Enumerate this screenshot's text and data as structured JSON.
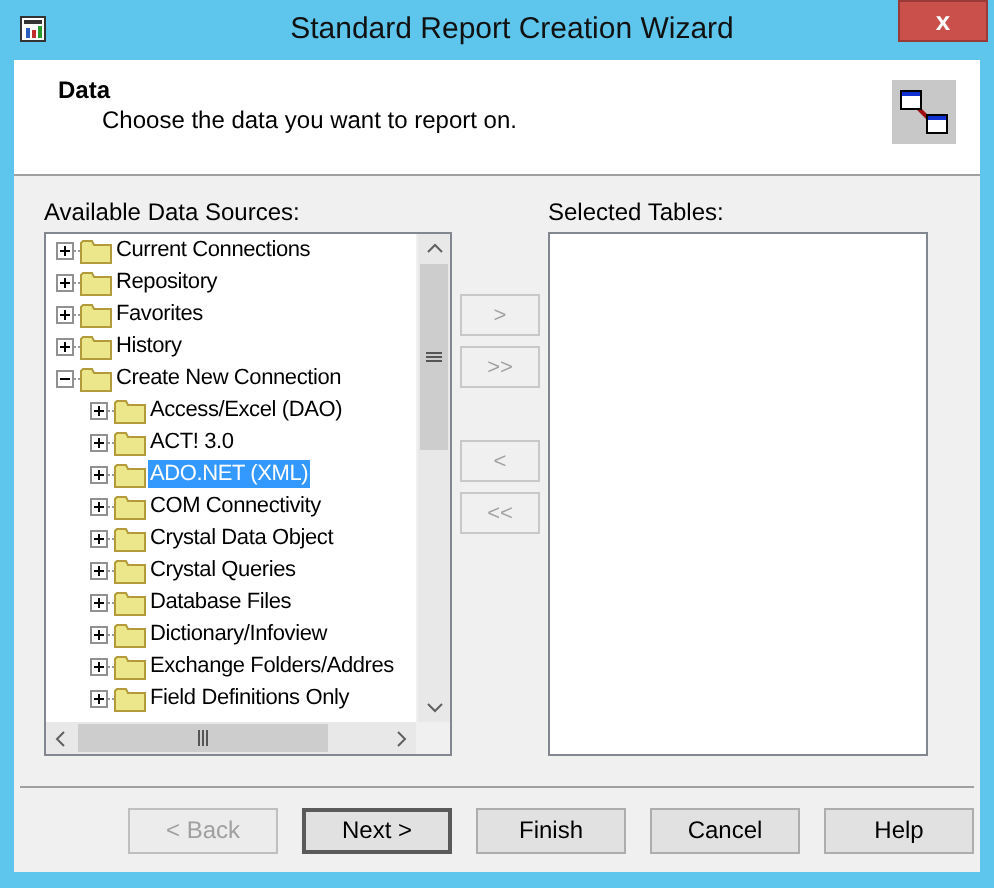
{
  "window": {
    "title": "Standard Report Creation Wizard",
    "close": "x"
  },
  "header": {
    "title": "Data",
    "subtitle": "Choose the data you want to report on."
  },
  "available": {
    "label": "Available Data Sources:",
    "items": [
      {
        "label": "Current Connections",
        "expanded": false,
        "selected": false
      },
      {
        "label": "Repository",
        "expanded": false,
        "selected": false
      },
      {
        "label": "Favorites",
        "expanded": false,
        "selected": false
      },
      {
        "label": "History",
        "expanded": false,
        "selected": false
      },
      {
        "label": "Create New Connection",
        "expanded": true,
        "selected": false,
        "children": [
          {
            "label": "Access/Excel (DAO)",
            "expanded": false,
            "selected": false
          },
          {
            "label": "ACT! 3.0",
            "expanded": false,
            "selected": false
          },
          {
            "label": "ADO.NET (XML)",
            "expanded": false,
            "selected": true
          },
          {
            "label": "COM Connectivity",
            "expanded": false,
            "selected": false
          },
          {
            "label": "Crystal Data Object",
            "expanded": false,
            "selected": false
          },
          {
            "label": "Crystal Queries",
            "expanded": false,
            "selected": false
          },
          {
            "label": "Database Files",
            "expanded": false,
            "selected": false
          },
          {
            "label": "Dictionary/Infoview",
            "expanded": false,
            "selected": false
          },
          {
            "label": "Exchange Folders/Addres",
            "expanded": false,
            "selected": false
          },
          {
            "label": "Field Definitions Only",
            "expanded": false,
            "selected": false
          }
        ]
      }
    ]
  },
  "transfer_buttons": [
    {
      "label": ">",
      "disabled": true
    },
    {
      "label": ">>",
      "disabled": true
    },
    {
      "label": "<",
      "disabled": true
    },
    {
      "label": "<<",
      "disabled": true
    }
  ],
  "selected_tables": {
    "label": "Selected Tables:"
  },
  "buttons": [
    {
      "label": "< Back",
      "disabled": true,
      "default": false
    },
    {
      "label": "Next >",
      "disabled": false,
      "default": true
    },
    {
      "label": "Finish",
      "disabled": false,
      "default": false
    },
    {
      "label": "Cancel",
      "disabled": false,
      "default": false
    },
    {
      "label": "Help",
      "disabled": false,
      "default": false
    }
  ]
}
